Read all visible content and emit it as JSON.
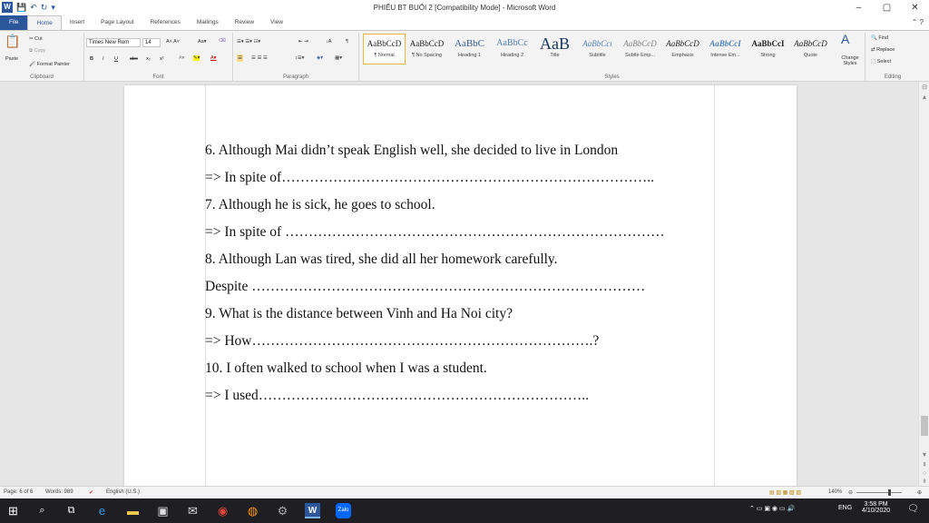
{
  "window": {
    "title": "PHIẾU BT BUỔI 2 [Compatibility Mode] - Microsoft Word",
    "app_badge": "W",
    "controls": [
      "–",
      "▢",
      "✕"
    ]
  },
  "tabs": [
    "File",
    "Home",
    "Insert",
    "Page Layout",
    "References",
    "Mailings",
    "Review",
    "View"
  ],
  "active_tab": "Home",
  "ribbon": {
    "clipboard": {
      "label": "Clipboard",
      "paste": "Paste",
      "cut": "Cut",
      "copy": "Copy",
      "format_painter": "Format Painter"
    },
    "font": {
      "label": "Font",
      "font_name": "Times New Rom",
      "font_size": "14",
      "bold": "B",
      "italic": "I",
      "underline": "U",
      "strike": "abc",
      "sub": "x₂",
      "sup": "x²"
    },
    "paragraph": {
      "label": "Paragraph",
      "pilcrow": "¶"
    },
    "styles": {
      "label": "Styles",
      "items": [
        {
          "preview": "AaBbCcD",
          "name": "¶ Normal"
        },
        {
          "preview": "AaBbCcD",
          "name": "¶ No Spacing"
        },
        {
          "preview": "AaBbC",
          "name": "Heading 1"
        },
        {
          "preview": "AaBbCc",
          "name": "Heading 2"
        },
        {
          "preview": "AaB",
          "name": "Title"
        },
        {
          "preview": "AaBbCcı",
          "name": "Subtitle"
        },
        {
          "preview": "AaBbCcD",
          "name": "Subtle Emp..."
        },
        {
          "preview": "AaBbCcD",
          "name": "Emphasis"
        },
        {
          "preview": "AaBbCcI",
          "name": "Intense Em..."
        },
        {
          "preview": "AaBbCcI",
          "name": "Strong"
        },
        {
          "preview": "AaBbCcD",
          "name": "Quote"
        }
      ],
      "change_styles": "Change Styles"
    },
    "editing": {
      "label": "Editing",
      "find": "Find",
      "replace": "Replace",
      "select": "Select"
    }
  },
  "document": {
    "lines": [
      "6. Although Mai didn’t speak English well, she decided to live in London",
      "=> In spite of……………………………………………………………………..",
      "7. Although he is sick, he goes to school.",
      "=>  In spite of ………………………………………………………………………",
      "8. Although Lan was tired, she did all her homework carefully.",
      "Despite …………………………………………………………………………",
      "9. What is the distance between Vinh and Ha Noi city?",
      "=> How……………………………………………………………….?",
      "10. I often walked to school when I was a student.",
      "=> I used…………………………………………………………….."
    ]
  },
  "status": {
    "page": "Page: 6 of 6",
    "words": "Words: 989",
    "language": "English (U.S.)",
    "zoom": "140%"
  },
  "taskbar": {
    "tray_lang": "ENG",
    "time": "3:58 PM",
    "date": "4/10/2020",
    "zalo": "Zalo"
  }
}
